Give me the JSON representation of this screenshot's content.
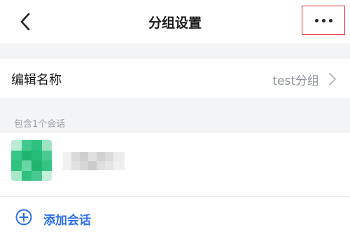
{
  "nav": {
    "title": "分组设置",
    "back_icon": "chevron-left-icon",
    "more_icon": "more-horizontal-icon",
    "highlight_color": "#e0312f"
  },
  "group_name_row": {
    "label": "编辑名称",
    "value": "test分组",
    "chevron_icon": "chevron-right-icon"
  },
  "section": {
    "label": "包含1个会话"
  },
  "conversation": {
    "avatar": "blurred-avatar",
    "name": "",
    "avatar_color": "#2ec27e"
  },
  "add_action": {
    "icon": "add-circle-icon",
    "label": "添加会话",
    "color": "#2b6ef0"
  }
}
